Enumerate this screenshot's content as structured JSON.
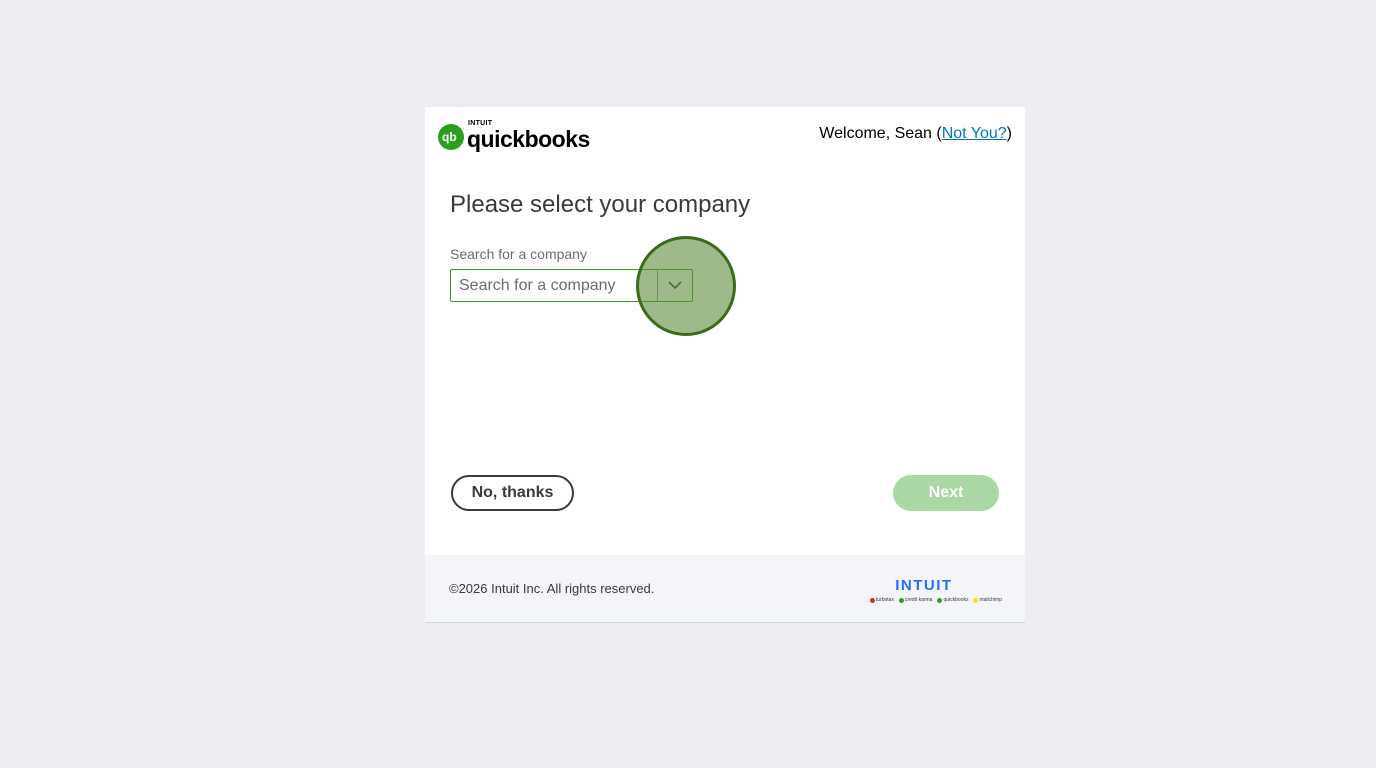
{
  "header": {
    "logo_small": "INTUIT",
    "logo_word": "quickbooks",
    "welcome_prefix": "Welcome, Sean (",
    "not_you_link": "Not You?",
    "welcome_suffix": ")"
  },
  "main": {
    "title": "Please select your company",
    "search_label": "Search for a company",
    "search_placeholder": "Search for a company",
    "search_value": ""
  },
  "actions": {
    "no_thanks": "No, thanks",
    "next": "Next"
  },
  "footer": {
    "copyright": "©2026 Intuit Inc. All rights reserved.",
    "brand": "INTUIT",
    "products": [
      {
        "label": "turbotax",
        "color": "#d52b1e"
      },
      {
        "label": "credit karma",
        "color": "#2ca01c"
      },
      {
        "label": "quickbooks",
        "color": "#2ca01c"
      },
      {
        "label": "mailchimp",
        "color": "#ffe01b"
      }
    ]
  },
  "colors": {
    "brand_green": "#2ca01c",
    "link_blue": "#0077c5",
    "next_disabled": "#a9d8a4",
    "click_marker": "#3b6a1a"
  }
}
